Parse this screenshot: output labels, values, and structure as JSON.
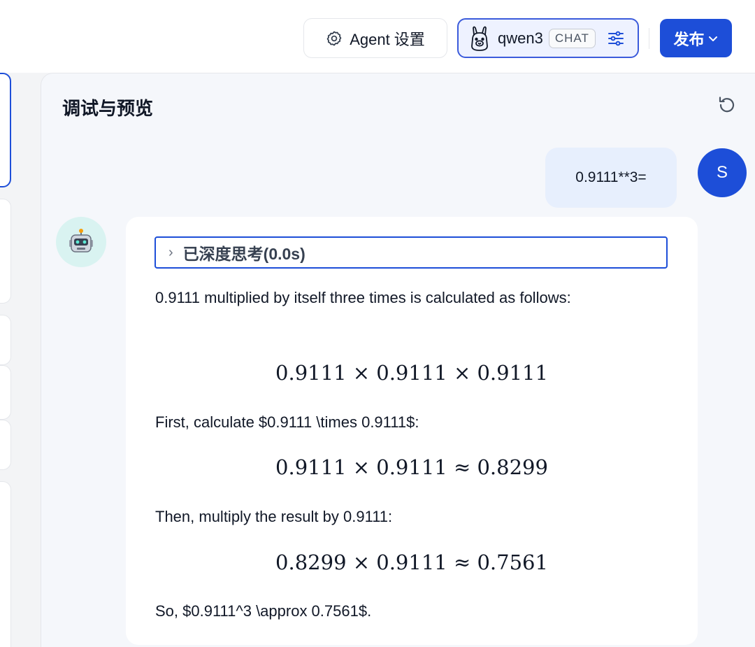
{
  "header": {
    "agent_settings_label": "Agent 设置",
    "model_name": "qwen3",
    "model_tag": "CHAT",
    "publish_label": "发布"
  },
  "panel": {
    "title": "调试与预览"
  },
  "user": {
    "avatar_letter": "S",
    "message": "0.9111**3="
  },
  "bot": {
    "thinking_label": "已深度思考(0.0s)",
    "p1": "0.9111 multiplied by itself three times is calculated as follows:",
    "m1": "0.9111 × 0.9111 × 0.9111",
    "p2": "First, calculate $0.9111 \\times 0.9111$:",
    "m2": "0.9111 × 0.9111 ≈ 0.8299",
    "p3": "Then, multiply the result by 0.9111:",
    "m3": "0.8299 × 0.9111 ≈ 0.7561",
    "p4": "So, $0.9111^3 \\approx 0.7561$."
  },
  "colors": {
    "accent": "#1d4ed8",
    "user_bubble": "#e7effd",
    "bot_avatar_bg": "#d9f3f1"
  }
}
